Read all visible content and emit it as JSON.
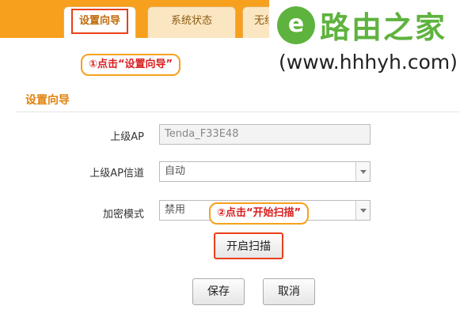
{
  "tabs": [
    {
      "label": "设置向导",
      "active": true
    },
    {
      "label": "系统状态",
      "active": false
    },
    {
      "label": "无线",
      "active": false
    }
  ],
  "logo": {
    "icon": "e-logo-icon",
    "title": "路由之家",
    "url": "(www.hhhyh.com)"
  },
  "callouts": {
    "step1": "①点击“设置向导”",
    "step2": "②点击“开始扫描”"
  },
  "section": {
    "title": "设置向导"
  },
  "form": {
    "upstream_ap_label": "上级AP",
    "upstream_ap_value": "Tenda_F33E48",
    "upstream_channel_label": "上级AP信道",
    "upstream_channel_value": "自动",
    "encryption_label": "加密模式",
    "encryption_value": "禁用"
  },
  "buttons": {
    "scan": "开启扫描",
    "save": "保存",
    "cancel": "取消"
  },
  "colors": {
    "accent": "#f6a01e",
    "highlight": "#e8401a",
    "logo_green": "#5eb33e"
  }
}
